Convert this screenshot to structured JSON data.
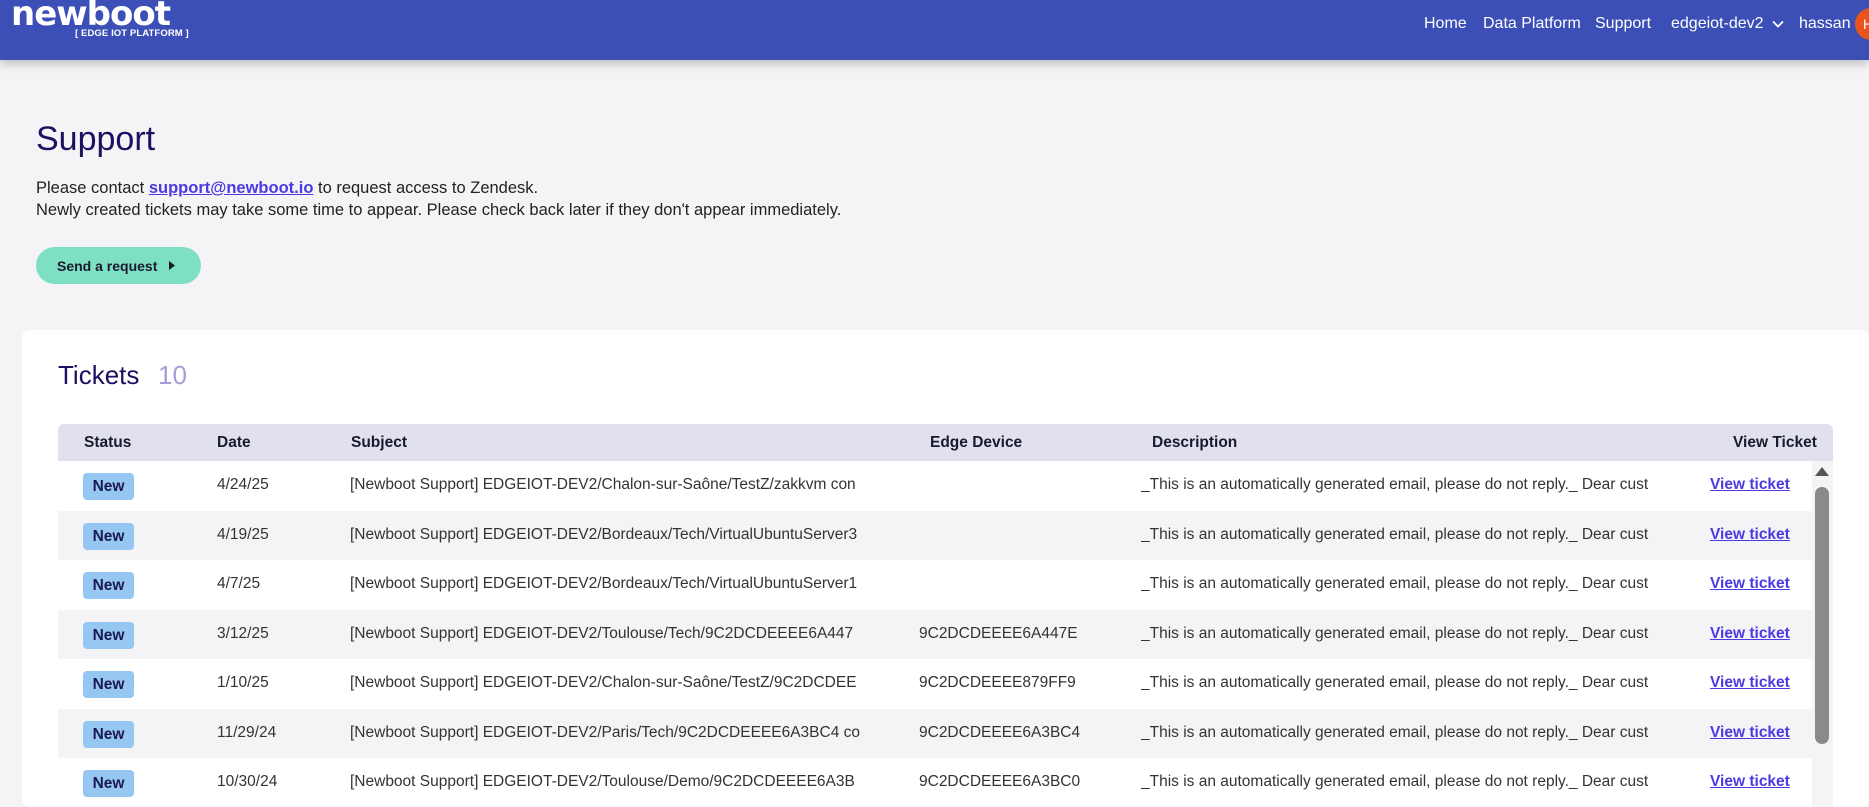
{
  "header": {
    "logo_text": "newboot",
    "logo_subtitle": "[ EDGE IOT PLATFORM ]",
    "nav": {
      "home": "Home",
      "data_platform": "Data Platform",
      "support": "Support"
    },
    "org_selector": "edgeiot-dev2",
    "user_name": "hassan",
    "avatar_initial": "H",
    "brand_color": "#3c4fb6"
  },
  "page": {
    "title": "Support",
    "info_prefix": "Please contact ",
    "support_email": "support@newboot.io",
    "info_suffix": " to request access to Zendesk.",
    "info_line2": "Newly created tickets may take some time to appear. Please check back later if they don't appear immediately.",
    "send_request_label": "Send a request"
  },
  "tickets": {
    "title": "Tickets",
    "count": "10",
    "columns": {
      "status": "Status",
      "date": "Date",
      "subject": "Subject",
      "edge_device": "Edge Device",
      "description": "Description",
      "view_ticket": "View Ticket"
    },
    "rows": [
      {
        "status": "New",
        "date": "4/24/25",
        "subject": "[Newboot Support] EDGEIOT-DEV2/Chalon-sur-Saône/TestZ/zakkvm con",
        "edge_device": "",
        "description": "_This is an automatically generated email, please do not reply._ Dear cust",
        "link": "View ticket"
      },
      {
        "status": "New",
        "date": "4/19/25",
        "subject": "[Newboot Support] EDGEIOT-DEV2/Bordeaux/Tech/VirtualUbuntuServer3",
        "edge_device": "",
        "description": "_This is an automatically generated email, please do not reply._ Dear cust",
        "link": "View ticket"
      },
      {
        "status": "New",
        "date": "4/7/25",
        "subject": "[Newboot Support] EDGEIOT-DEV2/Bordeaux/Tech/VirtualUbuntuServer1",
        "edge_device": "",
        "description": "_This is an automatically generated email, please do not reply._ Dear cust",
        "link": "View ticket"
      },
      {
        "status": "New",
        "date": "3/12/25",
        "subject": "[Newboot Support] EDGEIOT-DEV2/Toulouse/Tech/9C2DCDEEEE6A447",
        "edge_device": "9C2DCDEEEE6A447E",
        "description": "_This is an automatically generated email, please do not reply._ Dear cust",
        "link": "View ticket"
      },
      {
        "status": "New",
        "date": "1/10/25",
        "subject": "[Newboot Support] EDGEIOT-DEV2/Chalon-sur-Saône/TestZ/9C2DCDEE",
        "edge_device": "9C2DCDEEEE879FF9",
        "description": "_This is an automatically generated email, please do not reply._ Dear cust",
        "link": "View ticket"
      },
      {
        "status": "New",
        "date": "11/29/24",
        "subject": "[Newboot Support] EDGEIOT-DEV2/Paris/Tech/9C2DCDEEEE6A3BC4 co",
        "edge_device": "9C2DCDEEEE6A3BC4",
        "description": "_This is an automatically generated email, please do not reply._ Dear cust",
        "link": "View ticket"
      },
      {
        "status": "New",
        "date": "10/30/24",
        "subject": "[Newboot Support] EDGEIOT-DEV2/Toulouse/Demo/9C2DCDEEEE6A3B",
        "edge_device": "9C2DCDEEEE6A3BC0",
        "description": "_This is an automatically generated email, please do not reply._ Dear cust",
        "link": "View ticket"
      }
    ]
  }
}
